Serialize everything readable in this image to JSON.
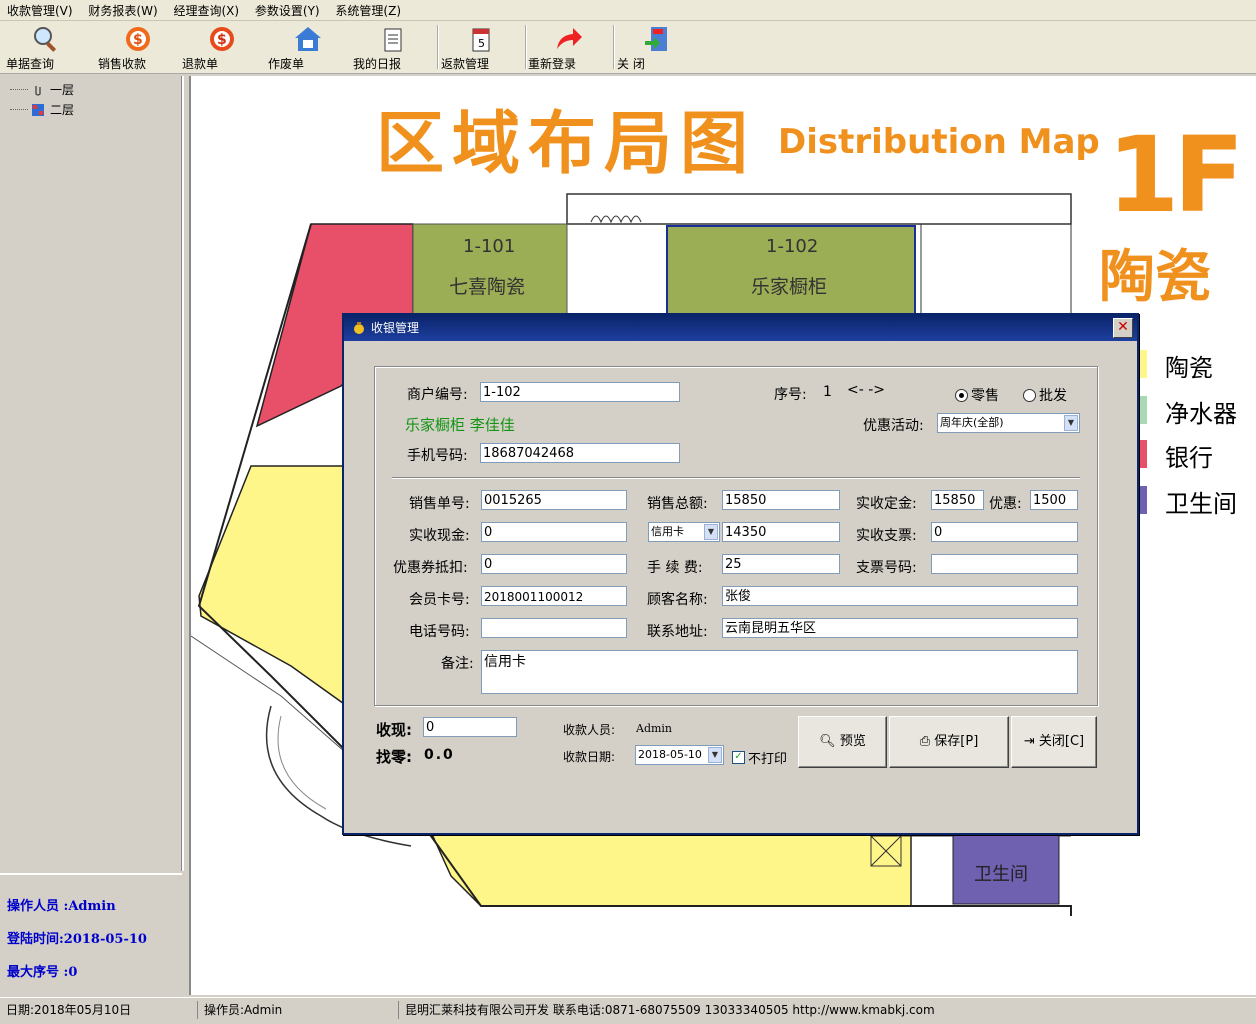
{
  "menu": [
    "收款管理(V)",
    "财务报表(W)",
    "经理查询(X)",
    "参数设置(Y)",
    "系统管理(Z)"
  ],
  "toolbar": [
    "单据查询",
    "销售收款",
    "退款单",
    "作废单",
    "我的日报",
    "返款管理",
    "重新登录",
    "关 闭"
  ],
  "tree": [
    "一层",
    "二层"
  ],
  "left_info": {
    "operator": "操作人员 :Admin",
    "login_time": "登陆时间:2018-05-10",
    "max_seq": "最大序号 :0"
  },
  "map": {
    "title_cn": "区域布局图",
    "title_en": "Distribution Map",
    "floor": "1F",
    "floor_name": "陶瓷",
    "shop1_no": "1-101",
    "shop1_name": "七喜陶瓷",
    "shop2_no": "1-102",
    "shop2_name": "乐家橱柜",
    "toilet": "卫生间",
    "legend": [
      {
        "label": "陶瓷",
        "color": "#fff68a"
      },
      {
        "label": "净水器",
        "color": "#a9d8b4"
      },
      {
        "label": "银行",
        "color": "#e8506a"
      },
      {
        "label": "卫生间",
        "color": "#7060b0"
      }
    ]
  },
  "dialog": {
    "title": "收银管理",
    "merchant_no_label": "商户编号:",
    "merchant_no": "1-102",
    "seq_label": "序号:",
    "seq": "1",
    "nav": "<-  ->",
    "radio_retail": "零售",
    "radio_wholesale": "批发",
    "merchant_info": "乐家橱柜  李佳佳",
    "promo_label": "优惠活动:",
    "promo_value": "周年庆(全部)",
    "phone_label": "手机号码:",
    "phone": "18687042468",
    "sale_no_label": "销售单号:",
    "sale_no": "0015265",
    "sale_total_label": "销售总额:",
    "sale_total": "15850",
    "deposit_label": "实收定金:",
    "deposit": "15850",
    "discount_label": "优惠:",
    "discount": "1500",
    "cash_label": "实收现金:",
    "cash": "0",
    "card_type": "信用卡",
    "card_amount": "14350",
    "cheque_label": "实收支票:",
    "cheque": "0",
    "coupon_label": "优惠券抵扣:",
    "coupon": "0",
    "fee_label": "手 续 费:",
    "fee": "25",
    "cheque_no_label": "支票号码:",
    "cheque_no": "",
    "member_label": "会员卡号:",
    "member_no": "2018001100012",
    "customer_label": "顾客名称:",
    "customer": "张俊",
    "tel_label": "电话号码:",
    "tel": "",
    "address_label": "联系地址:",
    "address": "云南昆明五华区",
    "remark_label": "备注:",
    "remark": "信用卡",
    "receive_label": "收现:",
    "receive": "0",
    "change_label": "找零:",
    "change": "0.0",
    "cashier_label": "收款人员:",
    "cashier": "Admin",
    "date_label": "收款日期:",
    "date": "2018-05-10",
    "noprint": "不打印",
    "btn_preview": "预览",
    "btn_save": "保存[P]",
    "btn_close": "关闭[C]"
  },
  "status": {
    "date": "日期:2018年05月10日",
    "operator": "操作员:Admin",
    "company": "昆明汇莱科技有限公司开发 联系电话:0871-68075509 13033340505 http://www.kmabkj.com"
  }
}
